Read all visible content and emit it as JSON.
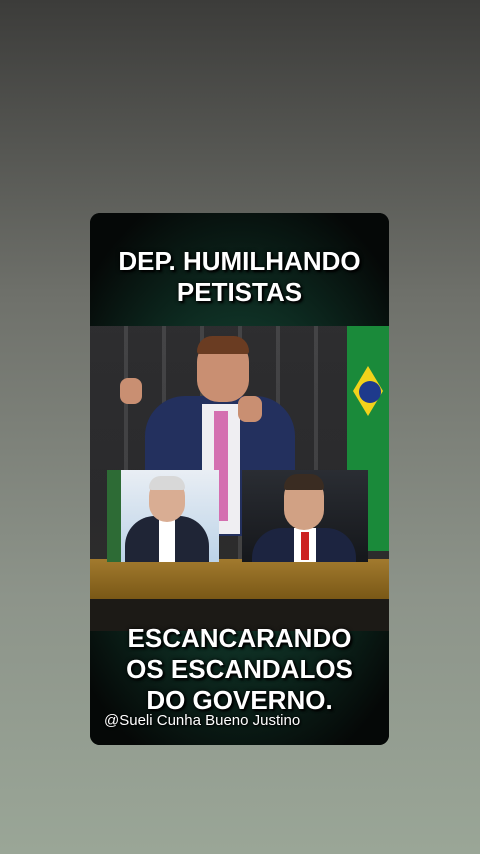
{
  "post": {
    "headline_top_line1": "DEP. HUMILHANDO",
    "headline_top_line2": "PETISTAS",
    "headline_bottom_line1": "ESCANCARANDO",
    "headline_bottom_line2": "OS ESCANDALOS",
    "headline_bottom_line3": "DO GOVERNO.",
    "watermark": "@Sueli Cunha Bueno Justino"
  },
  "colors": {
    "background_top": "#3c3c3a",
    "background_bottom": "#9aa697",
    "card_bg": "#050807",
    "card_glow": "#1d5a44",
    "text": "#ffffff"
  }
}
